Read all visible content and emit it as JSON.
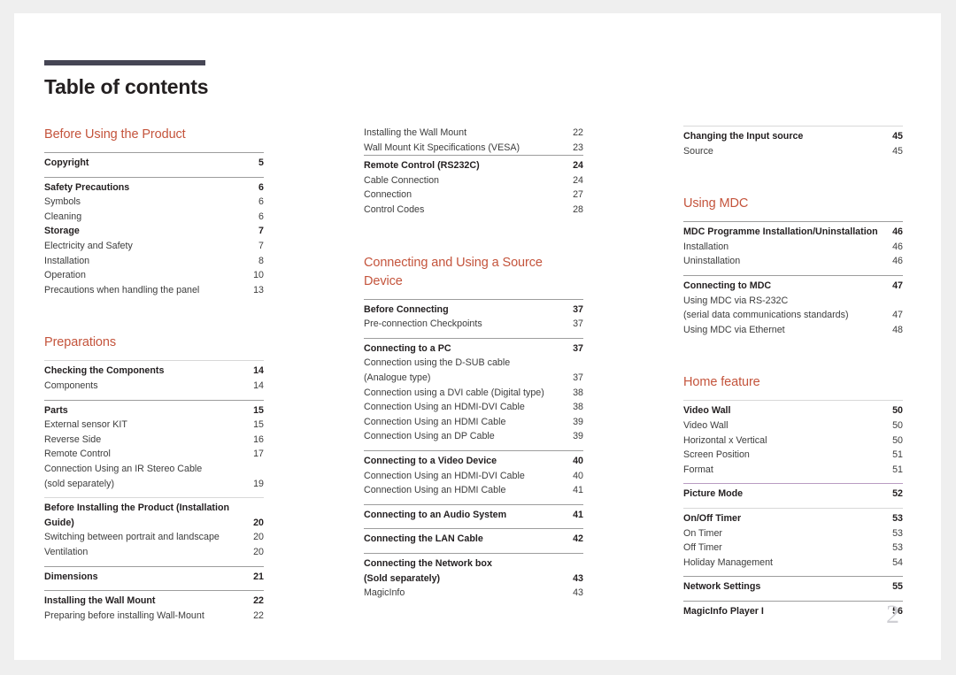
{
  "document": {
    "title": "Table of contents",
    "page_number": "2",
    "accent_color": "#c4543c",
    "rule_color": "#464655"
  },
  "columns": [
    {
      "name": "column-1",
      "blocks": [
        {
          "type": "section",
          "heading": "Before Using the Product",
          "groups": [
            {
              "rule": "dark",
              "entries": [
                {
                  "label": "Copyright",
                  "page": "5",
                  "bold": true
                }
              ]
            },
            {
              "rule": "dark",
              "entries": [
                {
                  "label": "Safety Precautions",
                  "page": "6",
                  "bold": true
                },
                {
                  "label": "Symbols",
                  "page": "6",
                  "bold": false
                },
                {
                  "label": "Cleaning",
                  "page": "6",
                  "bold": false
                },
                {
                  "label": "Storage",
                  "page": "7",
                  "bold": true
                },
                {
                  "label": "Electricity and Safety",
                  "page": "7",
                  "bold": false
                },
                {
                  "label": "Installation",
                  "page": "8",
                  "bold": false
                },
                {
                  "label": "Operation",
                  "page": "10",
                  "bold": false
                },
                {
                  "label": "Precautions when handling the panel",
                  "page": "13",
                  "bold": false
                }
              ]
            }
          ]
        },
        {
          "type": "section",
          "heading": "Preparations",
          "groups": [
            {
              "rule": "light",
              "entries": [
                {
                  "label": "Checking the Components",
                  "page": "14",
                  "bold": true
                },
                {
                  "label": "Components",
                  "page": "14",
                  "bold": false
                }
              ]
            },
            {
              "rule": "dark",
              "entries": [
                {
                  "label": "Parts",
                  "page": "15",
                  "bold": true
                },
                {
                  "label": "External sensor KIT",
                  "page": "15",
                  "bold": false
                },
                {
                  "label": "Reverse Side",
                  "page": "16",
                  "bold": false
                },
                {
                  "label": "Remote Control",
                  "page": "17",
                  "bold": false
                },
                {
                  "label": "Connection Using an IR Stereo Cable",
                  "page": "",
                  "bold": false
                },
                {
                  "label": "(sold separately)",
                  "page": "19",
                  "bold": false
                }
              ]
            },
            {
              "rule": "light",
              "entries": [
                {
                  "label": "Before Installing the Product (Installation",
                  "page": "",
                  "bold": true
                },
                {
                  "label": "Guide)",
                  "page": "20",
                  "bold": true
                },
                {
                  "label": "Switching between portrait and landscape",
                  "page": "20",
                  "bold": false
                },
                {
                  "label": "Ventilation",
                  "page": "20",
                  "bold": false
                }
              ]
            },
            {
              "rule": "dark",
              "entries": [
                {
                  "label": "Dimensions",
                  "page": "21",
                  "bold": true
                }
              ]
            },
            {
              "rule": "dark",
              "entries": [
                {
                  "label": "Installing the Wall Mount",
                  "page": "22",
                  "bold": true
                },
                {
                  "label": "Preparing before installing Wall-Mount",
                  "page": "22",
                  "bold": false
                }
              ]
            }
          ]
        }
      ]
    },
    {
      "name": "column-2",
      "blocks": [
        {
          "type": "continuation",
          "heading": "",
          "groups": [
            {
              "rule": "none",
              "entries": [
                {
                  "label": "Installing the Wall Mount",
                  "page": "22",
                  "bold": false
                },
                {
                  "label": "Wall Mount Kit Specifications (VESA)",
                  "page": "23",
                  "bold": false
                }
              ]
            },
            {
              "rule": "dark",
              "entries": [
                {
                  "label": "Remote Control (RS232C)",
                  "page": "24",
                  "bold": true
                },
                {
                  "label": "Cable Connection",
                  "page": "24",
                  "bold": false
                },
                {
                  "label": "Connection",
                  "page": "27",
                  "bold": false
                },
                {
                  "label": "Control Codes",
                  "page": "28",
                  "bold": false
                }
              ]
            }
          ]
        },
        {
          "type": "section",
          "heading": "Connecting and Using a Source Device",
          "groups": [
            {
              "rule": "dark",
              "entries": [
                {
                  "label": "Before Connecting",
                  "page": "37",
                  "bold": true
                },
                {
                  "label": "Pre-connection Checkpoints",
                  "page": "37",
                  "bold": false
                }
              ]
            },
            {
              "rule": "dark",
              "entries": [
                {
                  "label": "Connecting to a PC",
                  "page": "37",
                  "bold": true
                },
                {
                  "label": "Connection using the D-SUB cable",
                  "page": "",
                  "bold": false
                },
                {
                  "label": "(Analogue type)",
                  "page": "37",
                  "bold": false
                },
                {
                  "label": "Connection using a DVI cable (Digital type)",
                  "page": "38",
                  "bold": false
                },
                {
                  "label": "Connection Using an HDMI-DVI Cable",
                  "page": "38",
                  "bold": false
                },
                {
                  "label": "Connection Using an HDMI Cable",
                  "page": "39",
                  "bold": false
                },
                {
                  "label": "Connection Using an DP Cable",
                  "page": "39",
                  "bold": false
                }
              ]
            },
            {
              "rule": "dark",
              "entries": [
                {
                  "label": "Connecting to a Video Device",
                  "page": "40",
                  "bold": true
                },
                {
                  "label": "Connection Using an HDMI-DVI Cable",
                  "page": "40",
                  "bold": false
                },
                {
                  "label": "Connection Using an HDMI Cable",
                  "page": "41",
                  "bold": false
                }
              ]
            },
            {
              "rule": "dark",
              "entries": [
                {
                  "label": "Connecting to an Audio System",
                  "page": "41",
                  "bold": true
                }
              ]
            },
            {
              "rule": "dark",
              "entries": [
                {
                  "label": "Connecting the LAN Cable",
                  "page": "42",
                  "bold": true
                }
              ]
            },
            {
              "rule": "dark",
              "entries": [
                {
                  "label": "Connecting the Network box",
                  "page": "",
                  "bold": true
                },
                {
                  "label": "(Sold separately)",
                  "page": "43",
                  "bold": true
                },
                {
                  "label": "MagicInfo",
                  "page": "43",
                  "bold": false
                }
              ]
            }
          ]
        }
      ]
    },
    {
      "name": "column-3",
      "blocks": [
        {
          "type": "continuation",
          "heading": "",
          "groups": [
            {
              "rule": "light",
              "entries": [
                {
                  "label": "Changing the Input source",
                  "page": "45",
                  "bold": true
                },
                {
                  "label": "Source",
                  "page": "45",
                  "bold": false
                }
              ]
            }
          ]
        },
        {
          "type": "section",
          "heading": "Using MDC",
          "groups": [
            {
              "rule": "dark",
              "entries": [
                {
                  "label": "MDC Programme Installation/Uninstallation",
                  "page": "46",
                  "bold": true
                },
                {
                  "label": "Installation",
                  "page": "46",
                  "bold": false
                },
                {
                  "label": "Uninstallation",
                  "page": "46",
                  "bold": false
                }
              ]
            },
            {
              "rule": "dark",
              "entries": [
                {
                  "label": "Connecting to MDC",
                  "page": "47",
                  "bold": true
                },
                {
                  "label": "Using MDC via RS-232C",
                  "page": "",
                  "bold": false
                },
                {
                  "label": "(serial data communications standards)",
                  "page": "47",
                  "bold": false
                },
                {
                  "label": "Using MDC via Ethernet",
                  "page": "48",
                  "bold": false
                }
              ]
            }
          ]
        },
        {
          "type": "section",
          "heading": "Home feature",
          "groups": [
            {
              "rule": "light",
              "entries": [
                {
                  "label": "Video Wall",
                  "page": "50",
                  "bold": true
                },
                {
                  "label": "Video Wall",
                  "page": "50",
                  "bold": false
                },
                {
                  "label": "Horizontal x Vertical",
                  "page": "50",
                  "bold": false
                },
                {
                  "label": "Screen Position",
                  "page": "51",
                  "bold": false
                },
                {
                  "label": "Format",
                  "page": "51",
                  "bold": false
                }
              ]
            },
            {
              "rule": "purple",
              "entries": [
                {
                  "label": "Picture Mode",
                  "page": "52",
                  "bold": true
                }
              ]
            },
            {
              "rule": "light",
              "entries": [
                {
                  "label": "On/Off Timer",
                  "page": "53",
                  "bold": true
                },
                {
                  "label": "On Timer",
                  "page": "53",
                  "bold": false
                },
                {
                  "label": "Off Timer",
                  "page": "53",
                  "bold": false
                },
                {
                  "label": "Holiday Management",
                  "page": "54",
                  "bold": false
                }
              ]
            },
            {
              "rule": "dark",
              "entries": [
                {
                  "label": "Network Settings",
                  "page": "55",
                  "bold": true
                }
              ]
            },
            {
              "rule": "dark",
              "entries": [
                {
                  "label": "MagicInfo Player I",
                  "page": "56",
                  "bold": true
                }
              ]
            }
          ]
        }
      ]
    }
  ]
}
